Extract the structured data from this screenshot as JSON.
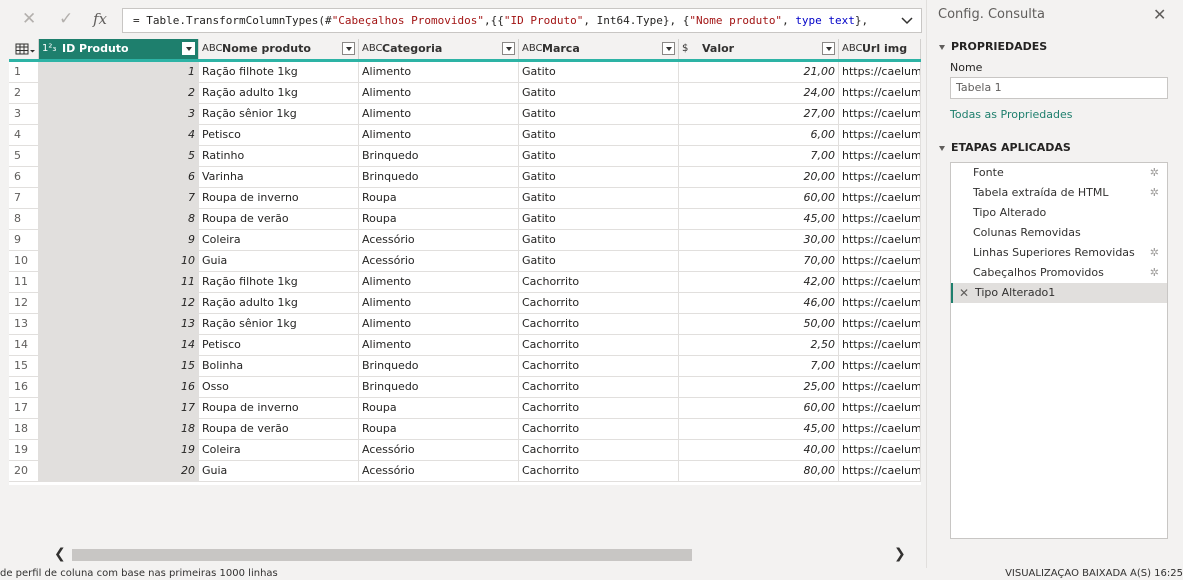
{
  "formula_bar": {
    "cancel_icon": "close-icon",
    "commit_icon": "check-icon",
    "fx_label": "fx",
    "formula_prefix": "= Table.TransformColumnTypes(#",
    "formula_str1": "\"Cabeçalhos Promovidos\"",
    "formula_mid1": ",{{",
    "formula_str2": "\"ID Produto\"",
    "formula_mid2": ", Int64.Type}, {",
    "formula_str3": "\"Nome produto\"",
    "formula_mid3": ", ",
    "formula_kw": "type text",
    "formula_end": "},"
  },
  "columns": [
    {
      "type": "1²₃",
      "label": "ID Produto"
    },
    {
      "type": "ABC",
      "label": "Nome produto"
    },
    {
      "type": "ABC",
      "label": "Categoria"
    },
    {
      "type": "ABC",
      "label": "Marca"
    },
    {
      "type": "$",
      "label": "Valor"
    },
    {
      "type": "ABC",
      "label": "Url img"
    }
  ],
  "rows": [
    {
      "idx": "1",
      "id": "1",
      "nome": "Ração filhote 1kg",
      "cat": "Alimento",
      "marca": "Gatito",
      "valor": "21,00",
      "url": "https://caelum-c"
    },
    {
      "idx": "2",
      "id": "2",
      "nome": "Ração adulto 1kg",
      "cat": "Alimento",
      "marca": "Gatito",
      "valor": "24,00",
      "url": "https://caelum-c"
    },
    {
      "idx": "3",
      "id": "3",
      "nome": "Ração sênior 1kg",
      "cat": "Alimento",
      "marca": "Gatito",
      "valor": "27,00",
      "url": "https://caelum-c"
    },
    {
      "idx": "4",
      "id": "4",
      "nome": "Petisco",
      "cat": "Alimento",
      "marca": "Gatito",
      "valor": "6,00",
      "url": "https://caelum-c"
    },
    {
      "idx": "5",
      "id": "5",
      "nome": "Ratinho",
      "cat": "Brinquedo",
      "marca": "Gatito",
      "valor": "7,00",
      "url": "https://caelum-c"
    },
    {
      "idx": "6",
      "id": "6",
      "nome": "Varinha",
      "cat": "Brinquedo",
      "marca": "Gatito",
      "valor": "20,00",
      "url": "https://caelum-c"
    },
    {
      "idx": "7",
      "id": "7",
      "nome": "Roupa de inverno",
      "cat": "Roupa",
      "marca": "Gatito",
      "valor": "60,00",
      "url": "https://caelum-c"
    },
    {
      "idx": "8",
      "id": "8",
      "nome": "Roupa de verão",
      "cat": "Roupa",
      "marca": "Gatito",
      "valor": "45,00",
      "url": "https://caelum-c"
    },
    {
      "idx": "9",
      "id": "9",
      "nome": "Coleira",
      "cat": "Acessório",
      "marca": "Gatito",
      "valor": "30,00",
      "url": "https://caelum-c"
    },
    {
      "idx": "10",
      "id": "10",
      "nome": "Guia",
      "cat": "Acessório",
      "marca": "Gatito",
      "valor": "70,00",
      "url": "https://caelum-c"
    },
    {
      "idx": "11",
      "id": "11",
      "nome": "Ração filhote 1kg",
      "cat": "Alimento",
      "marca": "Cachorrito",
      "valor": "42,00",
      "url": "https://caelum-c"
    },
    {
      "idx": "12",
      "id": "12",
      "nome": "Ração adulto 1kg",
      "cat": "Alimento",
      "marca": "Cachorrito",
      "valor": "46,00",
      "url": "https://caelum-c"
    },
    {
      "idx": "13",
      "id": "13",
      "nome": "Ração sênior 1kg",
      "cat": "Alimento",
      "marca": "Cachorrito",
      "valor": "50,00",
      "url": "https://caelum-c"
    },
    {
      "idx": "14",
      "id": "14",
      "nome": "Petisco",
      "cat": "Alimento",
      "marca": "Cachorrito",
      "valor": "2,50",
      "url": "https://caelum-c"
    },
    {
      "idx": "15",
      "id": "15",
      "nome": "Bolinha",
      "cat": "Brinquedo",
      "marca": "Cachorrito",
      "valor": "7,00",
      "url": "https://caelum-c"
    },
    {
      "idx": "16",
      "id": "16",
      "nome": "Osso",
      "cat": "Brinquedo",
      "marca": "Cachorrito",
      "valor": "25,00",
      "url": "https://caelum-c"
    },
    {
      "idx": "17",
      "id": "17",
      "nome": "Roupa de inverno",
      "cat": "Roupa",
      "marca": "Cachorrito",
      "valor": "60,00",
      "url": "https://caelum-c"
    },
    {
      "idx": "18",
      "id": "18",
      "nome": "Roupa de verão",
      "cat": "Roupa",
      "marca": "Cachorrito",
      "valor": "45,00",
      "url": "https://caelum-c"
    },
    {
      "idx": "19",
      "id": "19",
      "nome": "Coleira",
      "cat": "Acessório",
      "marca": "Cachorrito",
      "valor": "40,00",
      "url": "https://caelum-c"
    },
    {
      "idx": "20",
      "id": "20",
      "nome": "Guia",
      "cat": "Acessório",
      "marca": "Cachorrito",
      "valor": "80,00",
      "url": "https://caelum-c"
    }
  ],
  "status": {
    "left": "de perfil de coluna com base nas primeiras 1000 linhas",
    "right": "VISUALIZAÇÃO BAIXADA À(S) 16:25"
  },
  "side": {
    "title": "Config. Consulta",
    "properties_heading": "PROPRIEDADES",
    "name_label": "Nome",
    "name_value": "Tabela 1",
    "all_props_link": "Todas as Propriedades",
    "steps_heading": "ETAPAS APLICADAS",
    "steps": [
      {
        "label": "Fonte",
        "gear": true
      },
      {
        "label": "Tabela extraída de HTML",
        "gear": true
      },
      {
        "label": "Tipo Alterado",
        "gear": false
      },
      {
        "label": "Colunas Removidas",
        "gear": false
      },
      {
        "label": "Linhas Superiores Removidas",
        "gear": true
      },
      {
        "label": "Cabeçalhos Promovidos",
        "gear": true
      },
      {
        "label": "Tipo Alterado1",
        "gear": false,
        "active": true
      }
    ]
  },
  "colors": {
    "accent": "#1e7f6d",
    "header_underline": "#2db3a5"
  }
}
